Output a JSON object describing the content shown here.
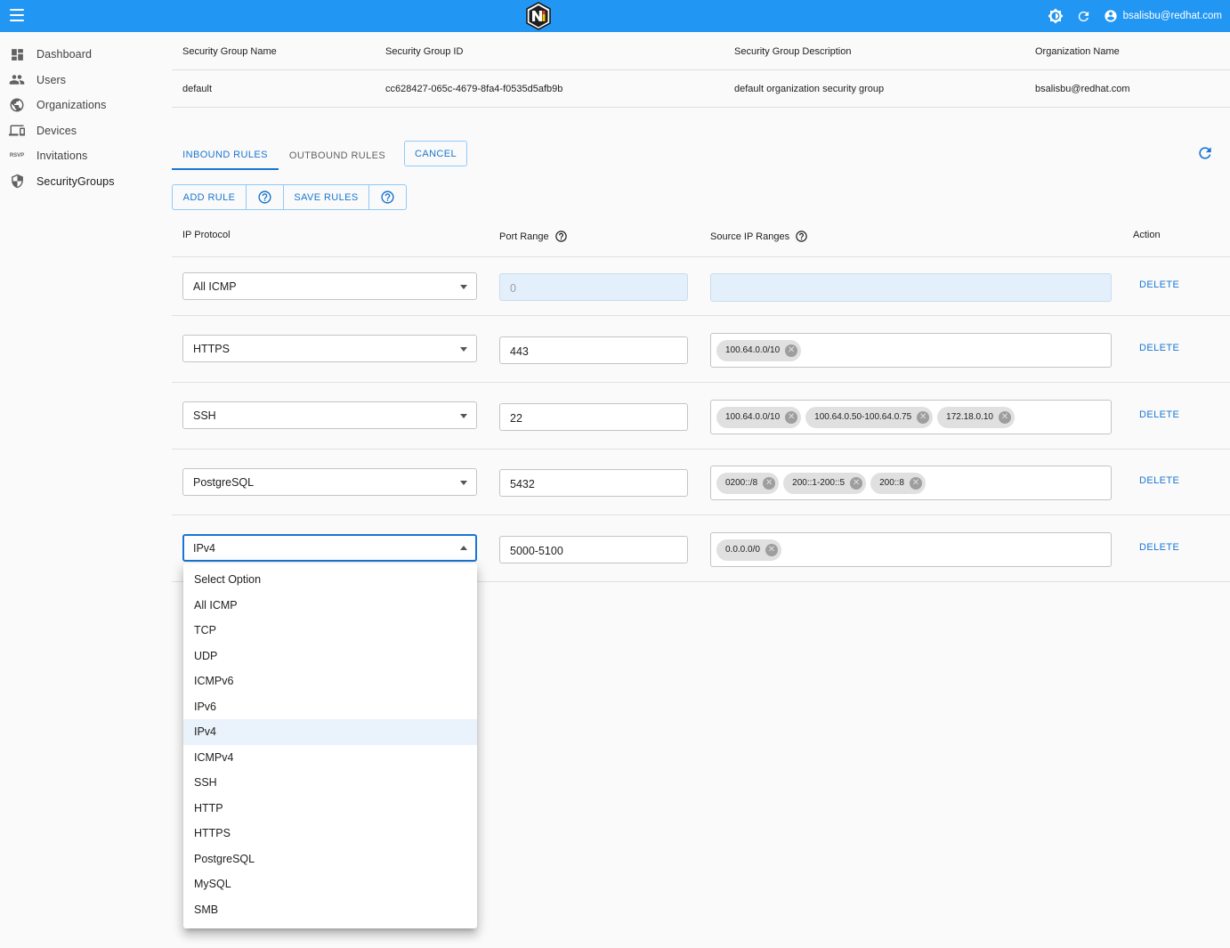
{
  "appbar": {
    "user_email": "bsalisbu@redhat.com",
    "brand_color": "#2196f3"
  },
  "sidebar": {
    "items": [
      {
        "label": "Dashboard",
        "icon": "dashboard-icon"
      },
      {
        "label": "Users",
        "icon": "people-icon"
      },
      {
        "label": "Organizations",
        "icon": "globe-icon"
      },
      {
        "label": "Devices",
        "icon": "devices-icon"
      },
      {
        "label": "Invitations",
        "icon": "rsvp-icon",
        "icon_text": "RSVP"
      },
      {
        "label": "SecurityGroups",
        "icon": "shield-icon"
      }
    ],
    "active": "SecurityGroups"
  },
  "group_table": {
    "headers": [
      "Security Group Name",
      "Security Group ID",
      "Security Group Description",
      "Organization Name"
    ],
    "row": [
      "default",
      "cc628427-065c-4679-8fa4-f0535d5afb9b",
      "default organization security group",
      "bsalisbu@redhat.com"
    ]
  },
  "tabs": {
    "inbound": "INBOUND RULES",
    "outbound": "OUTBOUND RULES",
    "cancel": "CANCEL",
    "active": "INBOUND RULES"
  },
  "toolbar": {
    "add_rule": "ADD RULE",
    "save_rules": "SAVE RULES"
  },
  "rules_table": {
    "headers": {
      "protocol": "IP Protocol",
      "port": "Port Range",
      "source": "Source IP Ranges",
      "action": "Action"
    },
    "delete_label": "DELETE",
    "rows": [
      {
        "protocol": "All ICMP",
        "port": "0",
        "port_disabled": true,
        "ips": [],
        "ips_disabled": true
      },
      {
        "protocol": "HTTPS",
        "port": "443",
        "port_disabled": false,
        "ips": [
          "100.64.0.0/10"
        ],
        "ips_disabled": false
      },
      {
        "protocol": "SSH",
        "port": "22",
        "port_disabled": false,
        "ips": [
          "100.64.0.0/10",
          "100.64.0.50-100.64.0.75",
          "172.18.0.10"
        ],
        "ips_disabled": false
      },
      {
        "protocol": "PostgreSQL",
        "port": "5432",
        "port_disabled": false,
        "ips": [
          "0200::/8",
          "200::1-200::5",
          "200::8"
        ],
        "ips_disabled": false
      },
      {
        "protocol": "IPv4",
        "port": "5000-5100",
        "port_disabled": false,
        "ips": [
          "0.0.0.0/0"
        ],
        "ips_disabled": false,
        "open": true
      }
    ]
  },
  "dropdown": {
    "options": [
      "Select Option",
      "All ICMP",
      "TCP",
      "UDP",
      "ICMPv6",
      "IPv6",
      "IPv4",
      "ICMPv4",
      "SSH",
      "HTTP",
      "HTTPS",
      "PostgreSQL",
      "MySQL",
      "SMB"
    ],
    "selected": "IPv4"
  }
}
